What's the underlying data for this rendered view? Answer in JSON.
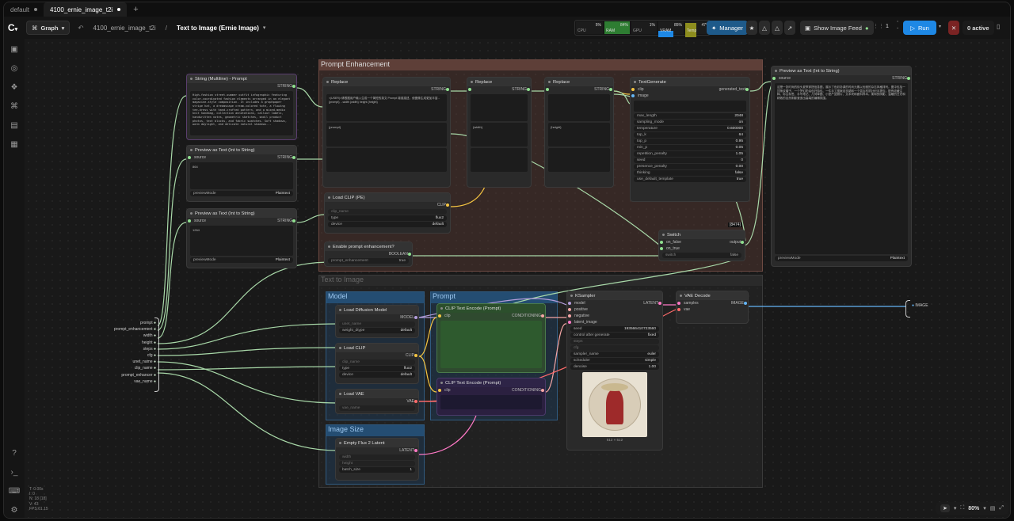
{
  "tabs": [
    {
      "label": "default"
    },
    {
      "label": "4100_ernie_image_t2i"
    }
  ],
  "toolbar": {
    "graph": "Graph",
    "workflow": "4100_ernie_image_t2i",
    "sep": "/",
    "subgraph": "Text to Image (Ernie Image)",
    "stats": [
      {
        "val": "5%",
        "label": "CPU"
      },
      {
        "val": "84%",
        "label": "RAM"
      },
      {
        "val": "1%",
        "label": "GPU"
      },
      {
        "val": "85%",
        "label": "VRAM"
      },
      {
        "val": "47°",
        "label": "Temp"
      }
    ],
    "manager": "Manager",
    "show_feed": "Show Image Feed",
    "queue_count": "1",
    "run": "Run",
    "active": "0 active"
  },
  "groups": {
    "prompt_enh": "Prompt Enhancement",
    "t2i": "Text to Image",
    "model": "Model",
    "prompt": "Prompt",
    "image_size": "Image Size"
  },
  "nodes": {
    "string_multiline": {
      "title": "String (Multiline) - Prompt",
      "out": "STRING",
      "text": "High-fashion street-summer outfit infographic featuring color-coordinated fashion elements arranged in an elegant magazine-style composition. It includes a graphpaper stripe hat, a dreamscape cream-colored tote, a flowing tee-dress with hand-crafted pattern, and a mixed-media knit handbag, collection annotations, callout labels, handwritten notes, geometric sketches, small product photos, text blocks, and fabric swatches. Soft shadows, warm daylight, and delicate natural shadows..."
    },
    "preview1": {
      "title": "Preview as Text (Int to String)",
      "in": "source",
      "out": "STRING",
      "value": "864",
      "mode": "previewMode",
      "mode_val": "Plaintext"
    },
    "preview2": {
      "title": "Preview as Text (Int to String)",
      "in": "source",
      "out": "STRING",
      "value": "1264",
      "mode": "previewMode",
      "mode_val": "Plaintext"
    },
    "replace1": {
      "title": "Replace",
      "out": "STRING",
      "text": "<|USER|>请根据用户输入生成一个简短的英文 Prompt 增强描述，使图像生成更加丰富... {prompt}  ...width {width} height {height}",
      "find": "{prompt}"
    },
    "replace2": {
      "title": "Replace",
      "out": "STRING",
      "find": "{width}"
    },
    "replace3": {
      "title": "Replace",
      "out": "STRING",
      "find": "{height}"
    },
    "textgen": {
      "title": "TextGenerate",
      "in1": "clip",
      "in2": "image",
      "out": "generated_text",
      "widgets": [
        [
          "max_length",
          "2048"
        ],
        [
          "sampling_mode",
          "on"
        ],
        [
          "temperature",
          "0.600000"
        ],
        [
          "top_k",
          "64"
        ],
        [
          "top_p",
          "0.95"
        ],
        [
          "min_p",
          "0.05"
        ],
        [
          "repetition_penalty",
          "1.05"
        ],
        [
          "seed",
          "0"
        ],
        [
          "presence_penalty",
          "0.00"
        ],
        [
          "thinking",
          "false"
        ],
        [
          "use_default_template",
          "true"
        ]
      ]
    },
    "loadclip_pe": {
      "title": "Load CLIP (PE)",
      "out": "CLIP",
      "w1": "clip_name",
      "w2": "type",
      "w2v": "flux2",
      "w3": "device",
      "w3v": "default"
    },
    "enable_pe": {
      "title": "Enable prompt enhancement?",
      "out": "BOOLEAN",
      "w1": "prompt_enhancement",
      "w1v": "true"
    },
    "switch": {
      "title": "Switch",
      "badge": "[8474]",
      "in1": "on_false",
      "in2": "on_true",
      "in3": "switch",
      "out": "output",
      "sw": "false"
    },
    "preview_right": {
      "title": "Preview as Text (Int to String)",
      "in": "source",
      "out": "STRING",
      "mode": "previewMode",
      "mode_val": "Plaintext",
      "text": "这是一张时尚的街头夏季穿搭信息图，展示了色彩协调的时尚元素以优雅的杂志风格排列。图中包括一顶条纹帽子、一个梦幻奶油色托特包、一件手工图案连衣裙和一个混合材质针织手提包，配有收藏注释、标注标签、手写笔记、几何草图、小型产品照片、文本块和面料样本。柔和的阴影、温暖的日光和精致的自然阴影营造出高端的编辑氛围。"
    },
    "load_diffusion": {
      "title": "Load Diffusion Model",
      "out": "MODEL",
      "w1": "unet_name",
      "w2": "weight_dtype",
      "w2v": "default"
    },
    "load_clip": {
      "title": "Load CLIP",
      "out": "CLIP",
      "w1": "clip_name",
      "w2": "type",
      "w2v": "flux2",
      "w3": "device",
      "w3v": "default"
    },
    "load_vae": {
      "title": "Load VAE",
      "out": "VAE",
      "w1": "vae_name"
    },
    "clip_pos": {
      "title": "CLIP Text Encode (Prompt)",
      "in": "clip",
      "out": "CONDITIONING"
    },
    "clip_neg": {
      "title": "CLIP Text Encode (Prompt)",
      "in": "clip",
      "out": "CONDITIONING"
    },
    "empty_latent": {
      "title": "Empty Flux 2 Latent",
      "out": "LATENT",
      "w1": "width",
      "w2": "height",
      "w3": "batch_size",
      "w3v": "1"
    },
    "ksampler": {
      "title": "KSampler",
      "out": "LATENT",
      "ins": [
        "model",
        "positive",
        "negative",
        "latent_image"
      ],
      "widgets": [
        [
          "seed",
          "193566410723560"
        ],
        [
          "control after generate",
          "fixed"
        ],
        [
          "steps",
          ""
        ],
        [
          "cfg",
          ""
        ],
        [
          "sampler_name",
          "euler"
        ],
        [
          "scheduler",
          "simple"
        ],
        [
          "denoise",
          "1.00"
        ]
      ],
      "size_label": "512 × 512"
    },
    "vae_decode": {
      "title": "VAE Decode",
      "in1": "samples",
      "in2": "vae",
      "out": "IMAGE"
    }
  },
  "subgraph_inputs": [
    "prompt",
    "prompt_enhancement",
    "width",
    "height",
    "steps",
    "cfg",
    "unet_name",
    "clip_name",
    "prompt_enhancer",
    "vae_name"
  ],
  "subgraph_output": "IMAGE",
  "info": [
    "T: 0.00s",
    "I: 0",
    "N: 18 [18]",
    "V: 43",
    "FPS:61.15"
  ],
  "zoom": "80%"
}
